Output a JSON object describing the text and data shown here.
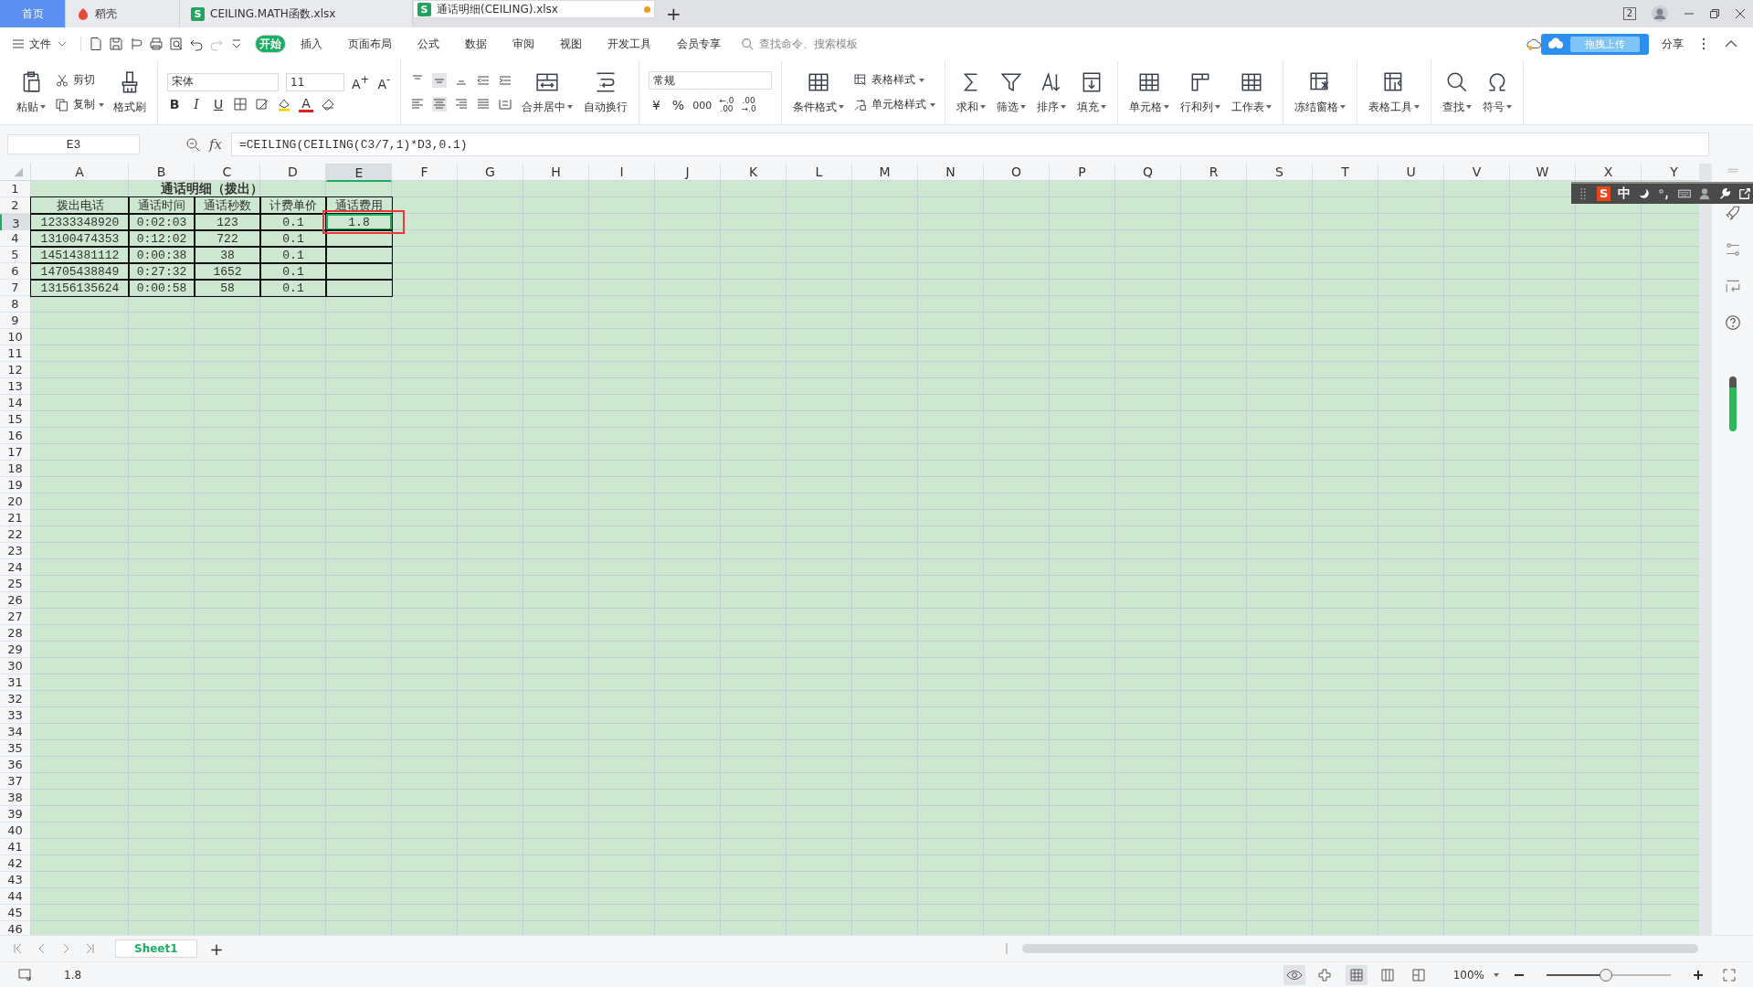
{
  "tabs": [
    {
      "label": "首页",
      "kind": "home",
      "selected": false
    },
    {
      "label": "稻壳",
      "kind": "docer",
      "selected": false
    },
    {
      "label": "CEILING.MATH函数.xlsx",
      "kind": "sheet",
      "badge": "S",
      "selected": false,
      "modified": false
    },
    {
      "label": "通话明细(CEILING).xlsx",
      "kind": "sheet",
      "badge": "S",
      "selected": true,
      "modified": true
    }
  ],
  "new_tab": "+",
  "window_count": "2",
  "menu": {
    "file": "文件",
    "tabs": [
      {
        "label": "开始",
        "selected": true
      },
      {
        "label": "插入",
        "selected": false
      },
      {
        "label": "页面布局",
        "selected": false
      },
      {
        "label": "公式",
        "selected": false
      },
      {
        "label": "数据",
        "selected": false
      },
      {
        "label": "审阅",
        "selected": false
      },
      {
        "label": "视图",
        "selected": false
      },
      {
        "label": "开发工具",
        "selected": false
      },
      {
        "label": "会员专享",
        "selected": false
      }
    ],
    "search": {
      "placeholder": "查找命令、搜索模板"
    },
    "upload_badge": "拖拽上传",
    "share": "分享"
  },
  "ribbon": {
    "clipboard": [
      {
        "label": "粘贴",
        "kind": "paste",
        "dropdown": true
      },
      {
        "label": "剪切",
        "kind": "cut",
        "dropdown": false
      },
      {
        "label": "复制",
        "kind": "copy",
        "dropdown": true
      },
      {
        "label": "格式刷",
        "kind": "brush",
        "dropdown": false
      }
    ],
    "font": {
      "name": "宋体",
      "size": "11",
      "grow": "A$^{+}$",
      "shrink": "A$^{-}$",
      "bold": "B",
      "italic": "I",
      "underline": "U",
      "color_letter": "A"
    },
    "align_buttons": [
      {
        "label": "合并居中",
        "kind": "merge",
        "dropdown": true
      },
      {
        "label": "自动换行",
        "kind": "wrap",
        "dropdown": false
      }
    ],
    "number": {
      "format": "常规",
      "currency": "¥",
      "percent": "%",
      "thousands": "000",
      "add_decimal": [
        "←.0",
        ".00"
      ],
      "remove_decimal": [
        ".00",
        "→.0"
      ]
    },
    "styles": [
      {
        "label": "条件格式",
        "kind": "condfmt",
        "dropdown": true
      },
      {
        "label": "表格样式",
        "kind": "tablestyle",
        "dropdown": true
      },
      {
        "label": "单元格样式",
        "kind": "cellstyle",
        "dropdown": true
      }
    ],
    "groups": [
      [
        {
          "label": "求和",
          "kind": "sum",
          "dropdown": true
        },
        {
          "label": "筛选",
          "kind": "filter",
          "dropdown": true
        },
        {
          "label": "排序",
          "kind": "sort",
          "dropdown": true
        },
        {
          "label": "填充",
          "kind": "fill",
          "dropdown": true
        }
      ],
      [
        {
          "label": "单元格",
          "kind": "cell",
          "dropdown": true
        },
        {
          "label": "行和列",
          "kind": "rowcol",
          "dropdown": true
        },
        {
          "label": "工作表",
          "kind": "sheet",
          "dropdown": true
        }
      ],
      [
        {
          "label": "冻结窗格",
          "kind": "freeze",
          "dropdown": true
        }
      ],
      [
        {
          "label": "表格工具",
          "kind": "tools",
          "dropdown": true
        }
      ],
      [
        {
          "label": "查找",
          "kind": "find",
          "dropdown": true
        },
        {
          "label": "符号",
          "kind": "symbol",
          "dropdown": true
        }
      ]
    ]
  },
  "formula_bar": {
    "name_box": "E3",
    "fx": "fx",
    "formula": "=CEILING(CEILING(C3/7,1)*D3,0.1)"
  },
  "sheet": {
    "columns": [
      {
        "label": "A",
        "selected": false
      },
      {
        "label": "B",
        "selected": false
      },
      {
        "label": "C",
        "selected": false
      },
      {
        "label": "D",
        "selected": false
      },
      {
        "label": "E",
        "selected": true
      },
      {
        "label": "F",
        "selected": false
      },
      {
        "label": "G",
        "selected": false
      },
      {
        "label": "H",
        "selected": false
      },
      {
        "label": "I",
        "selected": false
      },
      {
        "label": "J",
        "selected": false
      },
      {
        "label": "K",
        "selected": false
      },
      {
        "label": "L",
        "selected": false
      },
      {
        "label": "M",
        "selected": false
      },
      {
        "label": "N",
        "selected": false
      },
      {
        "label": "O",
        "selected": false
      },
      {
        "label": "P",
        "selected": false
      },
      {
        "label": "Q",
        "selected": false
      },
      {
        "label": "R",
        "selected": false
      },
      {
        "label": "S",
        "selected": false
      },
      {
        "label": "T",
        "selected": false
      },
      {
        "label": "U",
        "selected": false
      },
      {
        "label": "V",
        "selected": false
      },
      {
        "label": "W",
        "selected": false
      },
      {
        "label": "X",
        "selected": false
      },
      {
        "label": "Y",
        "selected": false
      }
    ],
    "row_numbers": [
      {
        "label": "1",
        "selected": false
      },
      {
        "label": "2",
        "selected": false
      },
      {
        "label": "3",
        "selected": true
      },
      {
        "label": "4",
        "selected": false
      },
      {
        "label": "5",
        "selected": false
      },
      {
        "label": "6",
        "selected": false
      },
      {
        "label": "7",
        "selected": false
      },
      {
        "label": "8",
        "selected": false
      },
      {
        "label": "9",
        "selected": false
      },
      {
        "label": "10",
        "selected": false
      },
      {
        "label": "11",
        "selected": false
      },
      {
        "label": "12",
        "selected": false
      },
      {
        "label": "13",
        "selected": false
      },
      {
        "label": "14",
        "selected": false
      },
      {
        "label": "15",
        "selected": false
      },
      {
        "label": "16",
        "selected": false
      },
      {
        "label": "17",
        "selected": false
      },
      {
        "label": "18",
        "selected": false
      },
      {
        "label": "19",
        "selected": false
      },
      {
        "label": "20",
        "selected": false
      },
      {
        "label": "21",
        "selected": false
      },
      {
        "label": "22",
        "selected": false
      },
      {
        "label": "23",
        "selected": false
      },
      {
        "label": "24",
        "selected": false
      },
      {
        "label": "25",
        "selected": false
      },
      {
        "label": "26",
        "selected": false
      },
      {
        "label": "27",
        "selected": false
      },
      {
        "label": "28",
        "selected": false
      },
      {
        "label": "29",
        "selected": false
      },
      {
        "label": "30",
        "selected": false
      },
      {
        "label": "31",
        "selected": false
      },
      {
        "label": "32",
        "selected": false
      },
      {
        "label": "33",
        "selected": false
      },
      {
        "label": "34",
        "selected": false
      },
      {
        "label": "35",
        "selected": false
      },
      {
        "label": "36",
        "selected": false
      },
      {
        "label": "37",
        "selected": false
      },
      {
        "label": "38",
        "selected": false
      },
      {
        "label": "39",
        "selected": false
      },
      {
        "label": "40",
        "selected": false
      },
      {
        "label": "41",
        "selected": false
      },
      {
        "label": "42",
        "selected": false
      },
      {
        "label": "43",
        "selected": false
      },
      {
        "label": "44",
        "selected": false
      },
      {
        "label": "45",
        "selected": false
      },
      {
        "label": "46",
        "selected": false
      }
    ],
    "title": "通话明细（拨出）",
    "header": [
      "拨出电话",
      "通话时间",
      "通话秒数",
      "计费单价",
      "通话费用"
    ],
    "rows": [
      [
        "12333348920",
        "0:02:03",
        "123",
        "0.1",
        "1.8"
      ],
      [
        "13100474353",
        "0:12:02",
        "722",
        "0.1"
      ],
      [
        "14514381112",
        "0:00:38",
        "38",
        "0.1"
      ],
      [
        "14705438849",
        "0:27:32",
        "1652",
        "0.1"
      ],
      [
        "13156135624",
        "0:00:58",
        "58",
        "0.1"
      ]
    ]
  },
  "ime_bar": {
    "badge": "S",
    "mode": "中"
  },
  "sheet_tabs": [
    {
      "label": "Sheet1",
      "selected": true
    }
  ],
  "add_sheet": "+",
  "status_bar": {
    "value": "1.8",
    "zoom": "100%",
    "zoom_slider": {
      "level": 0.48
    }
  }
}
